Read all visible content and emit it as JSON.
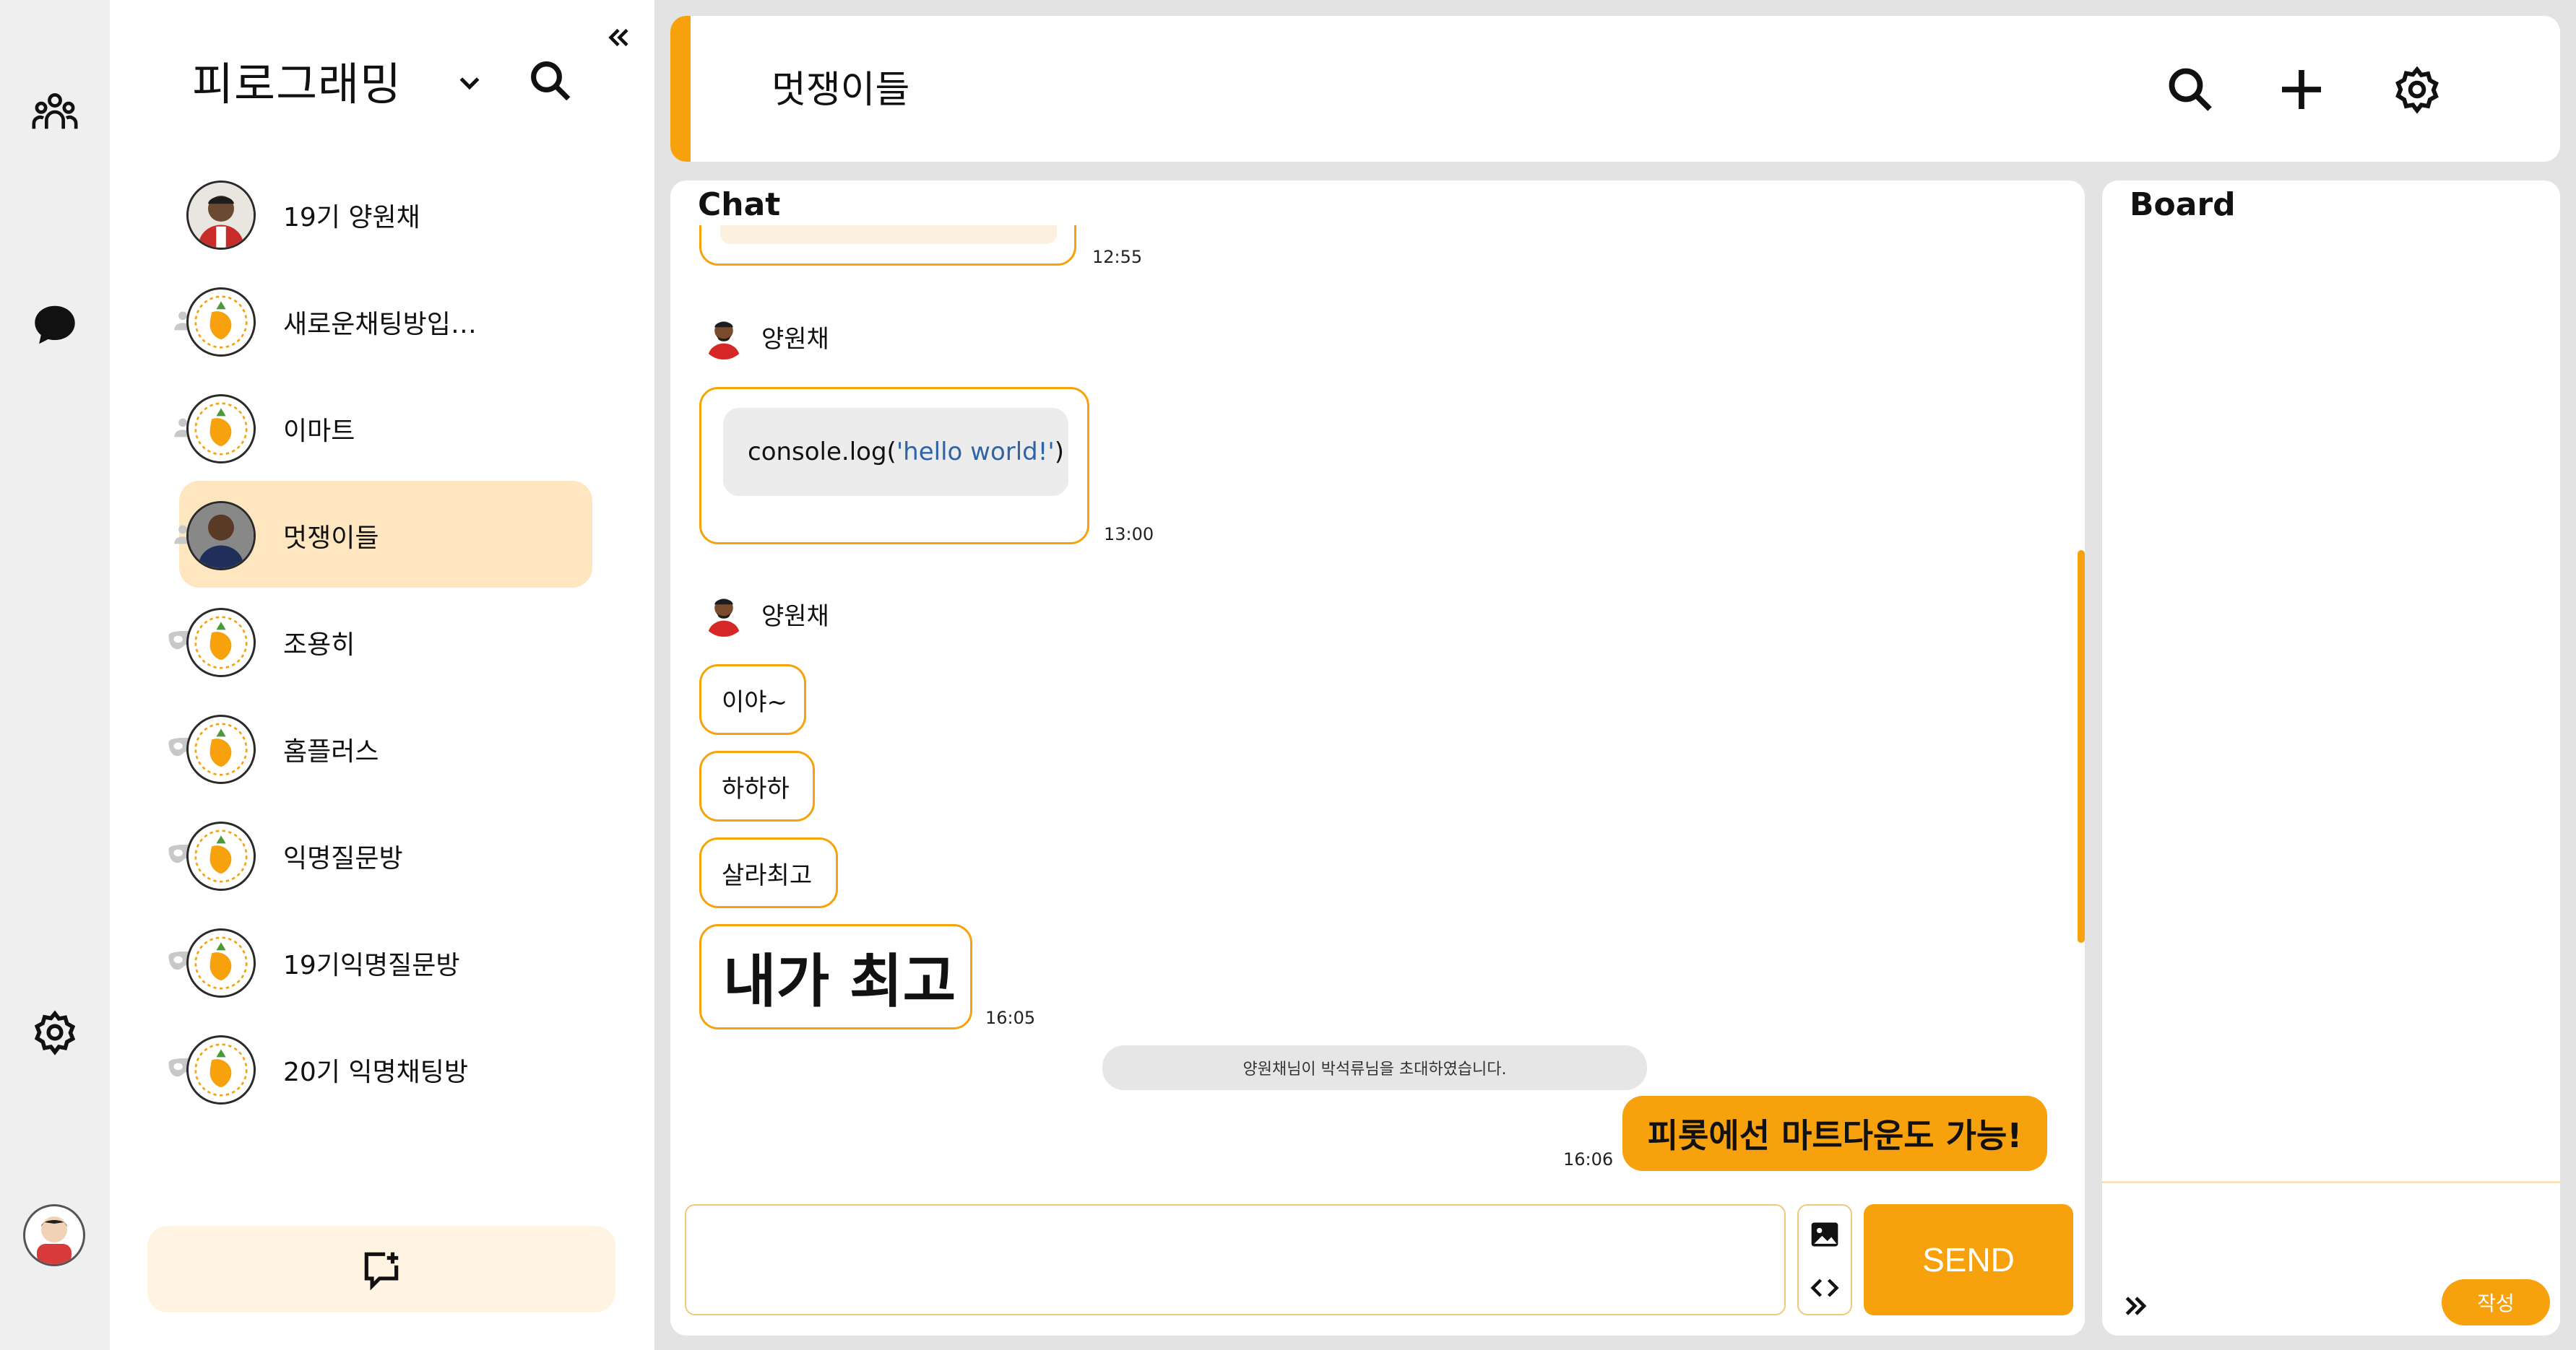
{
  "nav": {
    "icons": [
      "people-icon",
      "chat-bubble-icon",
      "gear-icon",
      "user-avatar"
    ]
  },
  "sidebar": {
    "workspace_title": "피로그래밍",
    "rooms": [
      {
        "name": "19기 양원채",
        "type": "direct"
      },
      {
        "name": "새로운채팅방입…",
        "type": "group"
      },
      {
        "name": "이마트",
        "type": "group"
      },
      {
        "name": "멋쟁이들",
        "type": "group",
        "active": true
      },
      {
        "name": "조용히",
        "type": "anonymous"
      },
      {
        "name": "홈플러스",
        "type": "anonymous"
      },
      {
        "name": "익명질문방",
        "type": "anonymous"
      },
      {
        "name": "19기익명질문방",
        "type": "anonymous"
      },
      {
        "name": "20기 익명채팅방",
        "type": "anonymous"
      }
    ]
  },
  "header": {
    "title": "멋쟁이들"
  },
  "chat": {
    "title": "Chat",
    "messages": {
      "first_time": "12:55",
      "group1": {
        "sender": "양원채",
        "code_prefix": "console.log(",
        "code_string": "'hello world!'",
        "code_suffix": ")",
        "time": "13:00"
      },
      "group2": {
        "sender": "양원채",
        "msg1": "이야~",
        "msg2": "하하하",
        "msg3": "살라최고",
        "msg4": "내가 최고",
        "time": "16:05"
      },
      "system": "양원채님이 박석류님을 초대하였습니다.",
      "mine": {
        "text": "피롯에선 마트다운도 가능!",
        "time": "16:06"
      }
    },
    "input": {
      "value": "",
      "send_label": "SEND"
    }
  },
  "board": {
    "title": "Board",
    "write_label": "작성"
  },
  "colors": {
    "accent": "#f7a10c",
    "active_room": "#fde6c0",
    "panel": "#ffffff",
    "background": "#e3e3e3"
  }
}
